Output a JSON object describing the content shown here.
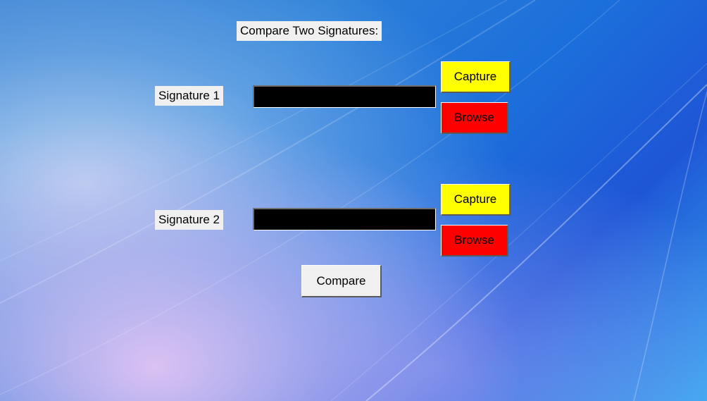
{
  "title": "Compare Two Signatures:",
  "signatures": [
    {
      "label": "Signature 1",
      "capture_label": "Capture",
      "browse_label": "Browse"
    },
    {
      "label": "Signature 2",
      "capture_label": "Capture",
      "browse_label": "Browse"
    }
  ],
  "compare_label": "Compare",
  "colors": {
    "capture": "#ffff00",
    "browse": "#ff0000",
    "field": "#000000",
    "label_bg": "#f0f0f0"
  }
}
